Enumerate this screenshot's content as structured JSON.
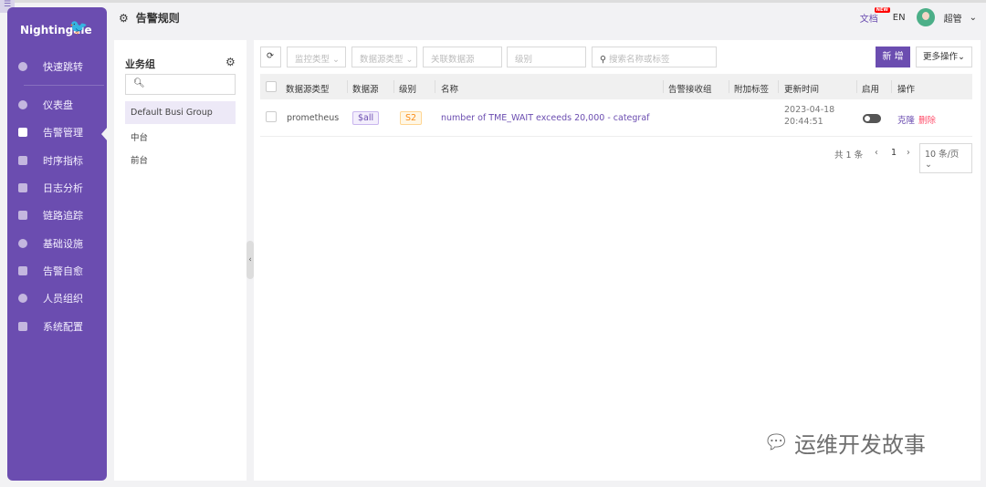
{
  "sidebar": {
    "logo": "Nightingale",
    "items": [
      {
        "label": "快速跳转",
        "icon": "search-icon"
      },
      {
        "label": "仪表盘",
        "icon": "dashboard-icon"
      },
      {
        "label": "告警管理",
        "icon": "alarm-icon",
        "active": true
      },
      {
        "label": "时序指标",
        "icon": "chart-icon"
      },
      {
        "label": "日志分析",
        "icon": "log-icon"
      },
      {
        "label": "链路追踪",
        "icon": "trace-icon"
      },
      {
        "label": "基础设施",
        "icon": "infra-icon"
      },
      {
        "label": "告警自愈",
        "icon": "heal-icon"
      },
      {
        "label": "人员组织",
        "icon": "user-icon"
      },
      {
        "label": "系统配置",
        "icon": "settings-icon"
      }
    ]
  },
  "header": {
    "title": "告警规则",
    "docs": "文档",
    "new_badge": "NEW",
    "lang": "EN",
    "user": "超管"
  },
  "groups": {
    "title": "业务组",
    "search_placeholder": "",
    "items": [
      "Default Busi Group",
      "中台",
      "前台"
    ]
  },
  "toolbar": {
    "monitor_type": "监控类型",
    "datasource_type": "数据源类型",
    "datasource": "关联数据源",
    "severity": "级别",
    "search_placeholder": "搜索名称或标签",
    "new_label": "新 增",
    "more_label": "更多操作"
  },
  "table": {
    "columns": [
      "数据源类型",
      "数据源",
      "级别",
      "名称",
      "告警接收组",
      "附加标签",
      "更新时间",
      "启用",
      "操作"
    ],
    "rows": [
      {
        "datasource_type": "prometheus",
        "datasource": "$all",
        "severity": "S2",
        "name": "number of TME_WAIT exceeds 20,000 - categraf",
        "notify_groups": "",
        "tags": "",
        "updated_date": "2023-04-18",
        "updated_time": "20:44:51",
        "enabled": false,
        "clone": "克隆",
        "delete": "删除"
      }
    ]
  },
  "pagination": {
    "total": "共 1 条",
    "page": "1",
    "page_size": "10 条/页"
  },
  "watermark": "运维开发故事",
  "colors": {
    "primary": "#6b4db0",
    "danger": "#ff4d6a",
    "severity": "#fa8c16"
  }
}
